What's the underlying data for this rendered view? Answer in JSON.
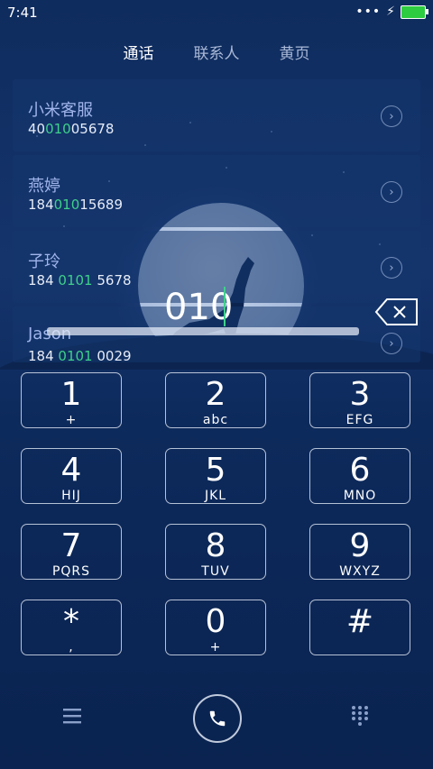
{
  "status": {
    "time": "7:41",
    "dots": "•••"
  },
  "tabs": [
    {
      "label": "通话",
      "active": true
    },
    {
      "label": "联系人",
      "active": false
    },
    {
      "label": "黄页",
      "active": false
    }
  ],
  "contacts": [
    {
      "name": "小米客服",
      "num_pre": "40",
      "num_hl": "010",
      "num_post": "05678"
    },
    {
      "name": "燕婷",
      "num_pre": "184",
      "num_hl": "010",
      "num_post": "15689"
    },
    {
      "name": "子玲",
      "num_pre": "184 ",
      "num_hl": "0101",
      "num_post": " 5678"
    },
    {
      "name": "Jason",
      "num_pre": "184 ",
      "num_hl": "0101",
      "num_post": " 0029"
    }
  ],
  "dial_input": {
    "value": "010"
  },
  "keys": [
    {
      "digit": "1",
      "letters": "+"
    },
    {
      "digit": "2",
      "letters": "abc"
    },
    {
      "digit": "3",
      "letters": "EFG"
    },
    {
      "digit": "4",
      "letters": "HIJ"
    },
    {
      "digit": "5",
      "letters": "JKL"
    },
    {
      "digit": "6",
      "letters": "MNO"
    },
    {
      "digit": "7",
      "letters": "PQRS"
    },
    {
      "digit": "8",
      "letters": "TUV"
    },
    {
      "digit": "9",
      "letters": "WXYZ"
    },
    {
      "digit": "*",
      "letters": ","
    },
    {
      "digit": "0",
      "letters": "+"
    },
    {
      "digit": "#",
      "letters": ""
    }
  ],
  "colors": {
    "highlight": "#3fd08a",
    "name": "#9fb4ea",
    "background": "#15346c"
  },
  "icons": {
    "menu": "menu-icon",
    "call": "phone-icon",
    "dialpad": "dialpad-icon",
    "backspace": "backspace-icon",
    "chevron": "chevron-right-icon"
  }
}
